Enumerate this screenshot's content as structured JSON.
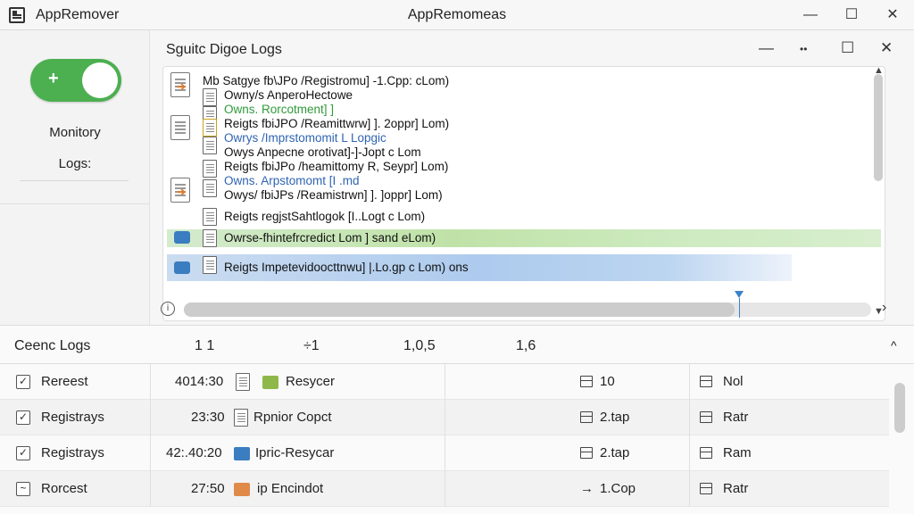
{
  "titlebar": {
    "app_name": "AppRemover",
    "window_title": "AppRemomeas",
    "minimize_glyph": "—",
    "maximize_glyph": "☐",
    "close_glyph": "✕"
  },
  "sidebar": {
    "toggle_symbol": "+",
    "toggle_on": true,
    "label_line1": "Monitory",
    "label_line2": "Logs:"
  },
  "panel": {
    "title": "Sguitc Digoe Logs",
    "ctrl_minimize": "—",
    "ctrl_more": "••",
    "ctrl_maximize": "☐",
    "ctrl_close": "✕",
    "log_lines": [
      {
        "text": "Mb Satgye fb\\JPo /Registromu] -1.Cpp:  cLom)",
        "style": "normal"
      },
      {
        "text": "Owny/s AnperoHectowe",
        "style": "normal"
      },
      {
        "text": "Owns. Rorcotment]   ]",
        "style": "green"
      },
      {
        "text": "Reigts fbiJPO /Reamittwrw] ]. 2oppr] Lom)",
        "style": "normal"
      },
      {
        "text": "Owrys /Imprstomomit   L Lopgic",
        "style": "blue"
      },
      {
        "text": "Owys Anpecne orotivat]-]-Jopt   c Lom",
        "style": "normal"
      },
      {
        "text": "Reigts fbiJPo /heamittomy R, Seypr] Lom)",
        "style": "normal"
      },
      {
        "text": "Owns. Arpstomomt   [I .md",
        "style": "blue"
      },
      {
        "text": "Owys/ fbiJPs /Reamistrwn] ]. ]oppr] Lom)",
        "style": "normal"
      },
      {
        "text": "Reigts regjstSahtlogok [I..Logt   c Lom)",
        "style": "normal"
      },
      {
        "text": "Owrse-fhintefrcredict Lom ] sand eLom)",
        "style": "normal"
      },
      {
        "text": "Reigts Impetevidoocttnwu] |.Lo.gp c Lom) ons",
        "style": "normal"
      }
    ],
    "info_glyph": "i",
    "scroll_next": "›",
    "scroll_up": "▲",
    "scroll_down": "▼"
  },
  "bottom": {
    "title": "Ceenc Logs",
    "columns": [
      "1 1",
      "÷1",
      "1,0,5",
      "1,6"
    ],
    "collapse_glyph": "^",
    "rows": [
      {
        "checked": true,
        "name": "Rereest",
        "time": "4014:30",
        "action": "Resycer",
        "size": "10",
        "status": "Nol",
        "tag_color": "#8fb84a"
      },
      {
        "checked": true,
        "name": "Registrays",
        "time": "23:30",
        "action": "Rpnior Copct",
        "size": "2.tap",
        "status": "Ratr",
        "tag_color": ""
      },
      {
        "checked": true,
        "name": "Registrays",
        "time": "42:.40:20",
        "action": "Ipric-Resycar",
        "size": "2.tap",
        "status": "Ram",
        "tag_color": "#3a7dc0"
      },
      {
        "checked": false,
        "name": "Rorcest",
        "time": "27:50",
        "action": "ip Encindot",
        "size": "1.Cop",
        "status": "Ratr",
        "tag_color": "#e08a4a"
      }
    ],
    "size_prefix_last": "→"
  },
  "colors": {
    "accent_green": "#4caf50",
    "log_green": "#2e9a3a",
    "log_blue": "#2f64b3",
    "marker_blue": "#3b82c8"
  }
}
